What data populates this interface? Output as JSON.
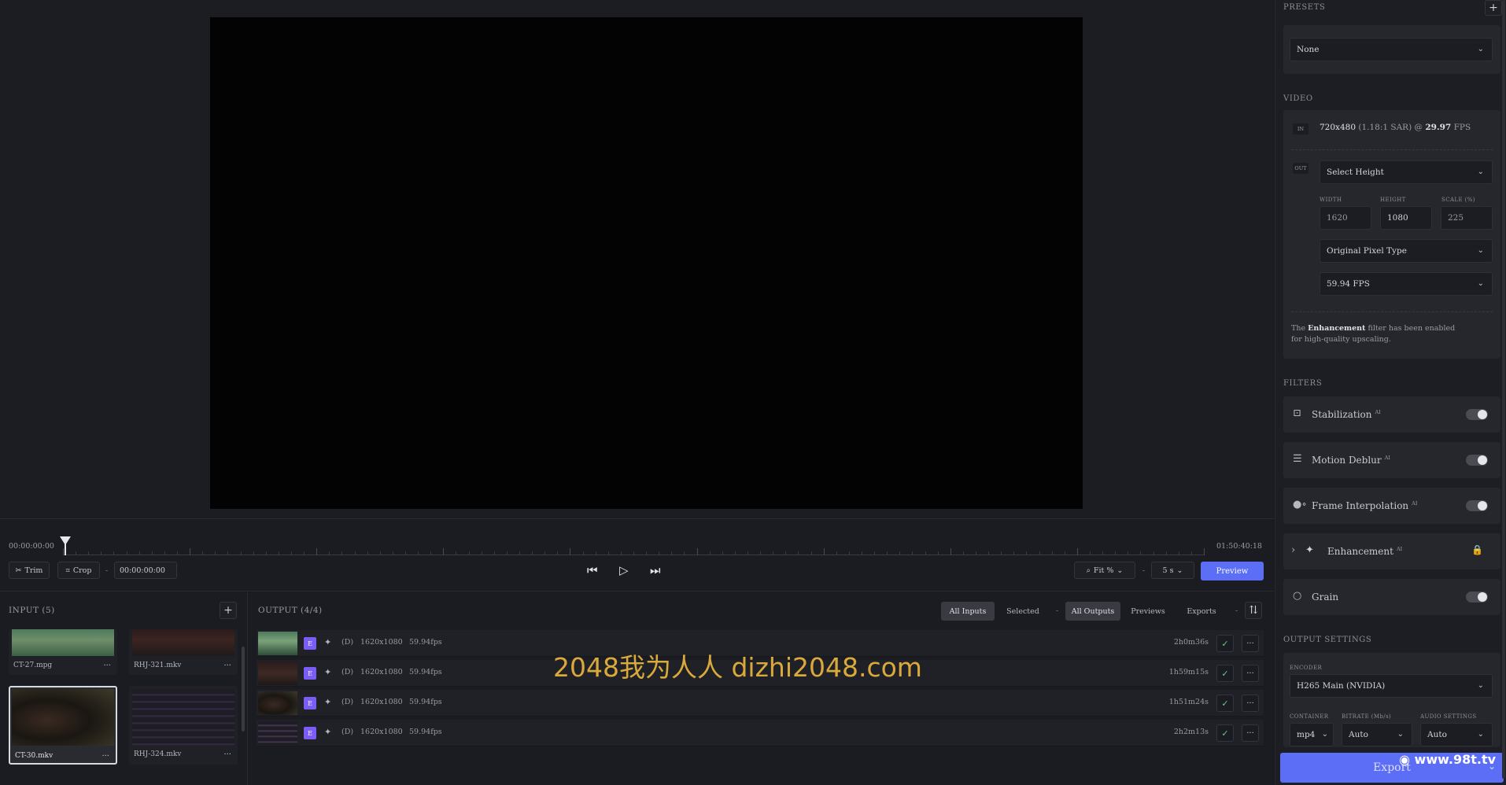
{
  "timeline": {
    "start_time": "00:00:00:00",
    "end_time": "01:50:40:18",
    "trim_label": "Trim",
    "crop_label": "Crop",
    "timecode": "00:00:00:00",
    "zoom_label": "Fit %",
    "step_label": "5 s",
    "preview_label": "Preview"
  },
  "input": {
    "title": "INPUT (5)",
    "items": [
      {
        "name": "CT-27.mpg"
      },
      {
        "name": "RHJ-321.mkv"
      },
      {
        "name": "CT-30.mkv"
      },
      {
        "name": "RHJ-324.mkv"
      }
    ],
    "more_glyph": "···"
  },
  "output": {
    "title": "OUTPUT (4/4)",
    "filters": [
      "All Inputs",
      "Selected",
      "All Outputs",
      "Previews",
      "Exports"
    ],
    "rows": [
      {
        "badge": "E",
        "d": "(D)",
        "res": "1620x1080",
        "fps": "59.94fps",
        "dur": "2h0m36s"
      },
      {
        "badge": "E",
        "d": "(D)",
        "res": "1620x1080",
        "fps": "59.94fps",
        "dur": "1h59m15s"
      },
      {
        "badge": "E",
        "d": "(D)",
        "res": "1620x1080",
        "fps": "59.94fps",
        "dur": "1h51m24s"
      },
      {
        "badge": "E",
        "d": "(D)",
        "res": "1620x1080",
        "fps": "59.94fps",
        "dur": "2h2m13s"
      }
    ]
  },
  "watermark": "2048我为人人  dizhi2048.com",
  "sidebar": {
    "presets_label": "PRESETS",
    "preset_value": "None",
    "video_label": "VIDEO",
    "in_tag": "IN",
    "out_tag": "OUT",
    "in_res": "720x480",
    "in_sar": "(1.18:1 SAR) @",
    "in_fps": "29.97",
    "in_fps_unit": "FPS",
    "select_height": "Select Height",
    "width_label": "WIDTH",
    "height_label": "HEIGHT",
    "scale_label": "SCALE (%)",
    "width_value": "1620",
    "height_value": "1080",
    "scale_value": "225",
    "pixel_type": "Original Pixel Type",
    "out_fps": "59.94 FPS",
    "note_pre": "The",
    "note_bold": "Enhancement",
    "note_post": "filter has been enabled",
    "note_line2": "for high-quality upscaling.",
    "filters_label": "FILTERS",
    "filters": [
      {
        "name": "Stabilization",
        "ai": "AI"
      },
      {
        "name": "Motion Deblur",
        "ai": "AI"
      },
      {
        "name": "Frame Interpolation",
        "ai": "AI"
      },
      {
        "name": "Enhancement",
        "ai": "AI"
      },
      {
        "name": "Grain",
        "ai": ""
      }
    ],
    "output_settings_label": "OUTPUT SETTINGS",
    "encoder_label": "ENCODER",
    "encoder_value": "H265 Main (NVIDIA)",
    "container_label": "CONTAINER",
    "bitrate_label": "BITRATE (Mb/s)",
    "audio_label": "AUDIO SETTINGS",
    "container_value": "mp4",
    "bitrate_value": "Auto",
    "audio_value": "Auto",
    "export_label": "Export",
    "site_logo": "www.98t.tv"
  }
}
